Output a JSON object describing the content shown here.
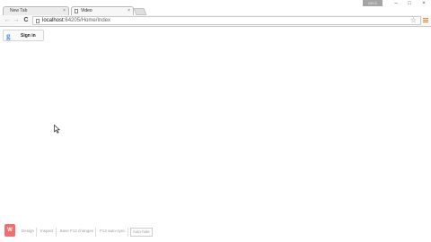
{
  "browser": {
    "tabs": [
      {
        "title": "New Tab",
        "close": "×"
      },
      {
        "title": "Video",
        "close": "×"
      }
    ],
    "user_pill": "DR.S",
    "window_controls": {
      "minimize": "–",
      "maximize": "□",
      "close": "×"
    },
    "nav": {
      "back": "←",
      "forward": "→",
      "reload": "C"
    },
    "address": {
      "host": "localhost",
      "rest": ":64205/Home/Index"
    },
    "star": "☆"
  },
  "page": {
    "signin": {
      "logo": "g",
      "label": "Sign in"
    }
  },
  "devtools_bar": {
    "logo": "W",
    "items": [
      "Design",
      "Inspect",
      "Save F12 changes",
      "F12 auto-sync",
      "Auto-hide"
    ]
  },
  "colors": {
    "accent_menu": "#e08a2c",
    "logo_bg": "#f06e6e",
    "google_blue": "#4285f4"
  }
}
